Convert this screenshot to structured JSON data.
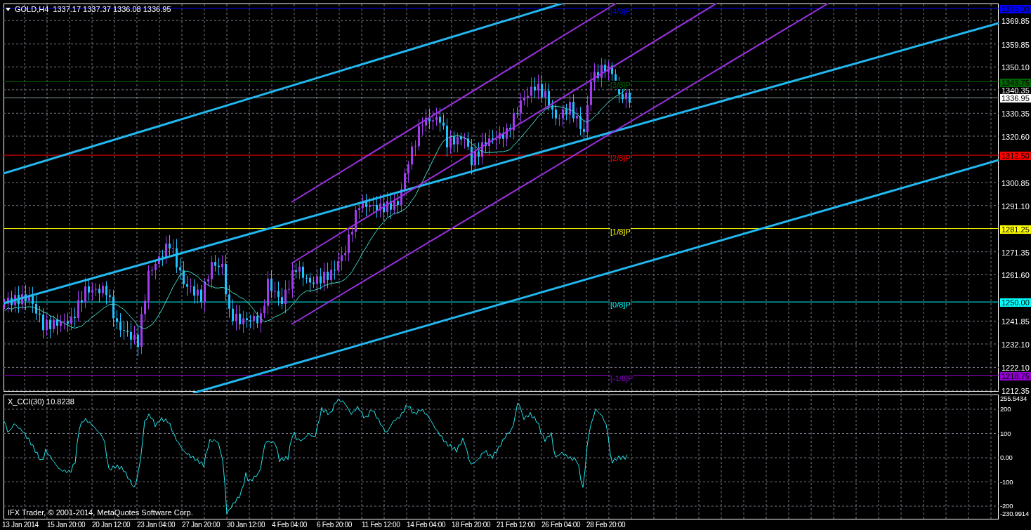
{
  "chart_header": {
    "symbol": "GOLD,H4",
    "quotes": "1337.17 1337.37 1336.08 1336.95"
  },
  "price_axis": {
    "ticks": [
      "1369.85",
      "1359.85",
      "1350.10",
      "1340.35",
      "1330.35",
      "1320.60",
      "1300.85",
      "1291.10",
      "1271.35",
      "1261.60",
      "1241.85",
      "1232.10",
      "1222.10",
      "1212.35"
    ],
    "levels": [
      {
        "price": "1375.00",
        "label": "[4/8]P",
        "color": "#0000ff"
      },
      {
        "price": "1343.75",
        "label": "[3/8]P",
        "color": "#006400"
      },
      {
        "price": "1336.95",
        "color": "#ffffff"
      },
      {
        "price": "1312.50",
        "label": "[2/8]P",
        "color": "#ff0000"
      },
      {
        "price": "1281.25",
        "label": "[1/8]P",
        "color": "#ffff00"
      },
      {
        "price": "1250.00",
        "label": "[0/8]P",
        "color": "#00ffff"
      },
      {
        "price": "1218.75",
        "label": "[-1/8]P",
        "color": "#9400d3"
      }
    ]
  },
  "indicator": {
    "title": "X_CCI(30) 10.8238",
    "ticks": [
      "255.5434",
      "200",
      "100",
      "0.00",
      "-100",
      "-200",
      "-230.9914"
    ],
    "copyright": "IFX Trader, © 2001-2014, MetaQuotes Software Corp."
  },
  "time_axis": [
    "13 Jan 2014",
    "15 Jan 20:00",
    "20 Jan 12:00",
    "23 Jan 04:00",
    "27 Jan 20:00",
    "30 Jan 12:00",
    "4 Feb 04:00",
    "6 Feb 20:00",
    "11 Feb 12:00",
    "14 Feb 04:00",
    "18 Feb 20:00",
    "21 Feb 12:00",
    "26 Feb 04:00",
    "28 Feb 20:00"
  ]
}
